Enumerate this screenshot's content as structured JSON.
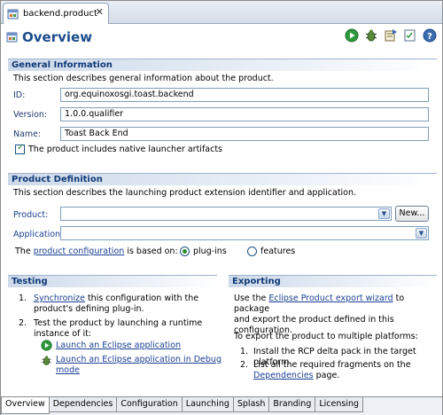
{
  "editor_tab": {
    "label": "backend.product",
    "close": "✕"
  },
  "header": {
    "title": "Overview"
  },
  "toolbar": {
    "icons": [
      "run-icon",
      "debug-icon",
      "export-icon",
      "synchronize-icon",
      "help-icon"
    ]
  },
  "general": {
    "title": "General Information",
    "description": "This section describes general information about the product.",
    "id_label": "ID:",
    "id_value": "org.equinoxosgi.toast.backend",
    "version_label": "Version:",
    "version_value": "1.0.0.qualifier",
    "name_label": "Name:",
    "name_value": "Toast Back End",
    "launcher_checkbox_label": "The product includes native launcher artifacts"
  },
  "definition": {
    "title": "Product Definition",
    "description": "This section describes the launching product extension identifier and application.",
    "product_label": "Product:",
    "product_value": "",
    "new_button": "New...",
    "application_label": "Application:",
    "application_value": "",
    "based_prefix": "The",
    "based_link": "product configuration",
    "based_suffix": "is based on:",
    "radio_plugins": "plug-ins",
    "radio_features": "features"
  },
  "testing": {
    "title": "Testing",
    "item1_num": "1.",
    "item1_link": "Synchronize",
    "item1_text": "this configuration with the",
    "item1_text2": "product's defining plug-in.",
    "item2_num": "2.",
    "item2_text": "Test the product by launching a runtime",
    "item2_text2": "instance of it:",
    "launch_link": "Launch an Eclipse application",
    "debug_link_line1": "Launch an Eclipse application in Debug",
    "debug_link_line2": "mode"
  },
  "exporting": {
    "title": "Exporting",
    "line1_prefix": "Use the",
    "line1_link": "Eclipse Product export wizard",
    "line1_suffix": "to package",
    "line2": "and export the product defined in this configuration.",
    "platforms_intro": "To export the product to multiple platforms:",
    "item1_num": "1.",
    "item1_text": "Install the RCP delta pack in the target platform.",
    "item2_num": "2.",
    "item2_text": "List all the required fragments on the",
    "item2_link": "Dependencies",
    "item2_suffix": "page."
  },
  "bottom_tabs": [
    "Overview",
    "Dependencies",
    "Configuration",
    "Launching",
    "Splash",
    "Branding",
    "Licensing"
  ],
  "colors": {
    "section_title": "#0f3a77",
    "link": "#1a3f93",
    "header_title": "#1c4c8c"
  }
}
